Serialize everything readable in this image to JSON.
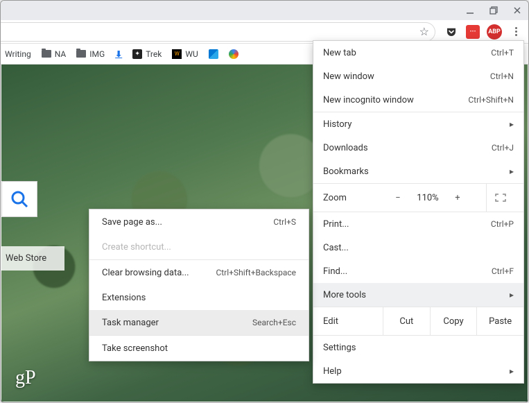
{
  "bookmarks": {
    "writing": "Writing",
    "na": "NA",
    "img": "IMG",
    "trek": "Trek",
    "wu": "WU"
  },
  "extensions": {
    "redsq": "···",
    "abp": "ABP"
  },
  "page": {
    "webstore": "Web Store",
    "logo": "gP"
  },
  "menu": {
    "new_tab": "New tab",
    "new_tab_sc": "Ctrl+T",
    "new_window": "New window",
    "new_window_sc": "Ctrl+N",
    "incognito": "New incognito window",
    "incognito_sc": "Ctrl+Shift+N",
    "history": "History",
    "downloads": "Downloads",
    "downloads_sc": "Ctrl+J",
    "bookmarks": "Bookmarks",
    "zoom": "Zoom",
    "zoom_minus": "−",
    "zoom_pct": "110%",
    "zoom_plus": "+",
    "print": "Print...",
    "print_sc": "Ctrl+P",
    "cast": "Cast...",
    "find": "Find...",
    "find_sc": "Ctrl+F",
    "more_tools": "More tools",
    "edit": "Edit",
    "cut": "Cut",
    "copy": "Copy",
    "paste": "Paste",
    "settings": "Settings",
    "help": "Help"
  },
  "submenu": {
    "save_as": "Save page as...",
    "save_as_sc": "Ctrl+S",
    "create_shortcut": "Create shortcut...",
    "clear_data": "Clear browsing data...",
    "clear_data_sc": "Ctrl+Shift+Backspace",
    "extensions": "Extensions",
    "task_manager": "Task manager",
    "task_manager_sc": "Search+Esc",
    "take_screenshot": "Take screenshot"
  },
  "arrow": "▸"
}
